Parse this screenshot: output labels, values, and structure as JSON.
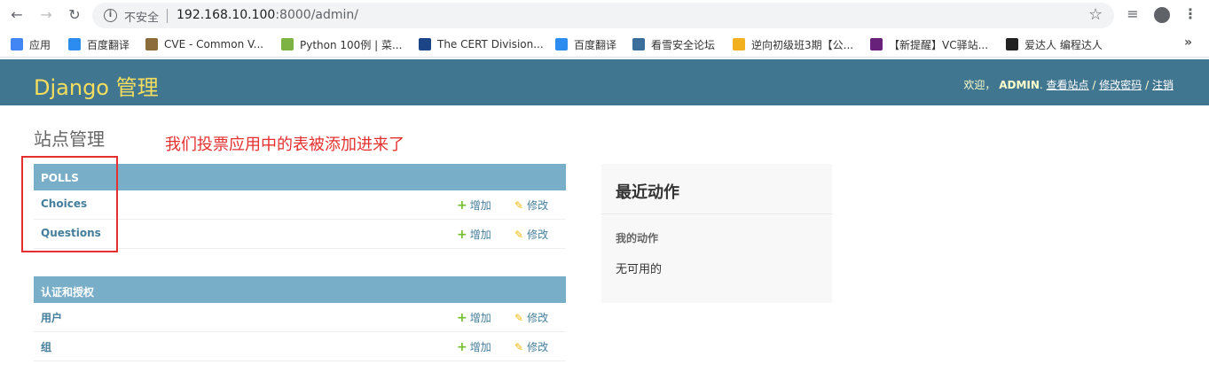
{
  "browser": {
    "not_secure": "不安全",
    "url_host": "192.168.10.100",
    "url_rest": ":8000/admin/",
    "bookmarks": [
      {
        "label": "应用",
        "icon": "apps-grid-icon",
        "color": "#4285f4"
      },
      {
        "label": "百度翻译",
        "icon": "translate-icon",
        "color": "#2d8cf0"
      },
      {
        "label": "CVE - Common V...",
        "icon": "cve-icon",
        "color": "#8a6d3b"
      },
      {
        "label": "Python 100例 | 菜...",
        "icon": "runoob-icon",
        "color": "#7cb342"
      },
      {
        "label": "The CERT Division...",
        "icon": "cert-icon",
        "color": "#1c4587"
      },
      {
        "label": "百度翻译",
        "icon": "translate-icon",
        "color": "#2d8cf0"
      },
      {
        "label": "看雪安全论坛",
        "icon": "snowflake-icon",
        "color": "#3c6e9c"
      },
      {
        "label": "逆向初级班3期【公...",
        "icon": "trophy-icon",
        "color": "#f2b01e"
      },
      {
        "label": "【新提醒】VC驿站...",
        "icon": "vs-icon",
        "color": "#68217a"
      },
      {
        "label": "爱达人 编程达人",
        "icon": "adaren-icon",
        "color": "#222222"
      }
    ]
  },
  "header": {
    "branding": "Django 管理",
    "welcome": "欢迎，",
    "username": "ADMIN",
    "view_site": "查看站点",
    "sep": "/",
    "change_password": "修改密码",
    "logout": "注销"
  },
  "content": {
    "site_title": "站点管理",
    "annotation": "我们投票应用中的表被添加进来了",
    "modules": [
      {
        "caption": "Polls",
        "models": [
          {
            "name": "Choices",
            "add": "增加",
            "change": "修改"
          },
          {
            "name": "Questions",
            "add": "增加",
            "change": "修改"
          }
        ]
      },
      {
        "caption": "认证和授权",
        "models": [
          {
            "name": "用户",
            "add": "增加",
            "change": "修改"
          },
          {
            "name": "组",
            "add": "增加",
            "change": "修改"
          }
        ]
      }
    ]
  },
  "recent_actions": {
    "title": "最近动作",
    "subtitle": "我的动作",
    "empty": "无可用的"
  },
  "colors": {
    "header_bg": "#417690",
    "branding": "#f5dd5d",
    "caption_bg": "#79aec8",
    "link": "#447e9b",
    "annotation": "#e53030"
  }
}
